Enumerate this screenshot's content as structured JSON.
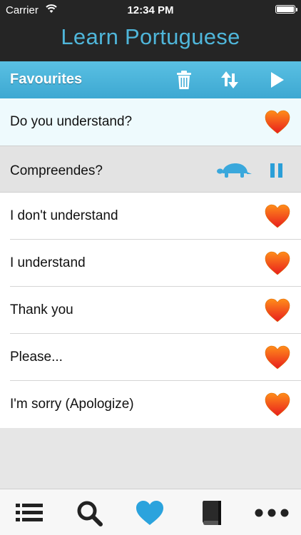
{
  "status_bar": {
    "carrier": "Carrier",
    "time": "12:34 PM"
  },
  "app": {
    "title": "Learn Portuguese"
  },
  "toolbar": {
    "label": "Favourites",
    "icons": [
      "trash-icon",
      "sort-icon",
      "play-icon"
    ]
  },
  "selected_phrase": {
    "english": "Do you understand?"
  },
  "playing_phrase": {
    "portuguese": "Compreendes?",
    "icons": [
      "turtle-slow-icon",
      "pause-icon"
    ]
  },
  "phrases": [
    {
      "text": "I don't understand"
    },
    {
      "text": "I understand"
    },
    {
      "text": "Thank you"
    },
    {
      "text": "Please..."
    },
    {
      "text": "I'm sorry (Apologize)"
    }
  ],
  "tabbar": {
    "icons": [
      "list-icon",
      "search-icon",
      "heart-icon",
      "book-icon",
      "more-icon"
    ],
    "active": "heart-icon"
  },
  "colors": {
    "accent": "#4fb6da",
    "header": "#252525",
    "toolbar": "#45aed7",
    "heart_top": "#ff8a1a",
    "heart_bottom": "#ea1f1f"
  }
}
